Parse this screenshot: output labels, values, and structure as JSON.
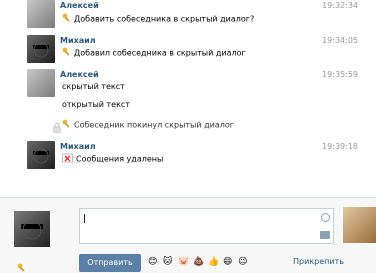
{
  "messages": [
    {
      "author": "Алексей",
      "time": "19:32:34",
      "avatar": "avatar-aleksey",
      "lines": [
        {
          "text": "Добавить собеседника в скрытый диалог?",
          "icon": "key-icon"
        }
      ]
    },
    {
      "author": "Михаил",
      "time": "19:34:05",
      "avatar": "avatar-mikhail",
      "lines": [
        {
          "text": "Добавил собеседника в скрытый диалог",
          "icon": "key-icon"
        }
      ]
    },
    {
      "author": "Алексей",
      "time": "19:35:59",
      "avatar": "avatar-aleksey",
      "lines": [
        {
          "text": "скрытый текст",
          "icon": ""
        },
        {
          "text": "открытый текст",
          "icon": ""
        },
        {
          "text": "Собеседник покинул скрытый диалог",
          "icon": "key-icon"
        }
      ]
    },
    {
      "author": "Михаил",
      "time": "19:39:18",
      "avatar": "avatar-mikhail",
      "lines": [
        {
          "text": "Сообщения удалены",
          "icon": "delete-messages-icon"
        }
      ]
    }
  ],
  "composer": {
    "input_value": "",
    "send_label": "Отправить",
    "attach_label": "Прикрепить",
    "emoji": [
      "😊",
      "🐱",
      "🐷",
      "💩",
      "👍",
      "😄",
      "😉"
    ]
  },
  "colors": {
    "name": "#2b587a",
    "send_bg": "#5b7fa6",
    "time": "#999999"
  }
}
